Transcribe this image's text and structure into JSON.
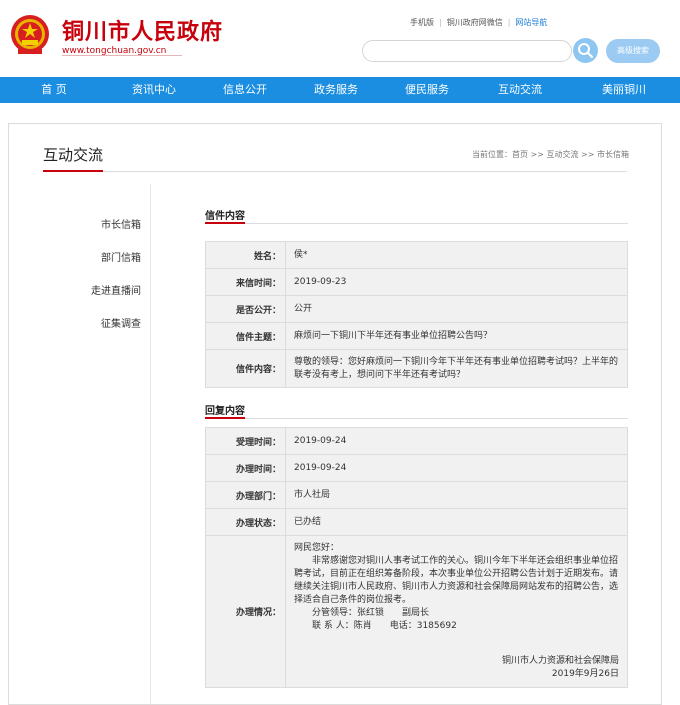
{
  "header": {
    "site_title": "铜川市人民政府",
    "site_url": "www.tongchuan.gov.cn",
    "links": [
      "手机版",
      "铜川政府网微信",
      "网站导航"
    ],
    "search_placeholder": "",
    "advanced_search": "高级搜索"
  },
  "nav": [
    "首 页",
    "资讯中心",
    "信息公开",
    "政务服务",
    "便民服务",
    "互动交流",
    "美丽铜川"
  ],
  "page": {
    "heading": "互动交流",
    "breadcrumb": "当前位置：首页 >> 互动交流 >> 市长信箱"
  },
  "sidebar": [
    "市长信箱",
    "部门信箱",
    "走进直播间",
    "征集调查"
  ],
  "letter": {
    "title": "信件内容",
    "rows": [
      {
        "label": "姓名：",
        "value": "侯*"
      },
      {
        "label": "来信时间：",
        "value": "2019-09-23"
      },
      {
        "label": "是否公开：",
        "value": "公开"
      },
      {
        "label": "信件主题：",
        "value": "麻烦问一下铜川下半年还有事业单位招聘公告吗？"
      },
      {
        "label": "信件内容：",
        "value": "尊敬的领导：您好麻烦问一下铜川今年下半年还有事业单位招聘考试吗？上半年的联考没有考上，想问问下半年还有考试吗？"
      }
    ]
  },
  "reply": {
    "title": "回复内容",
    "rows": [
      {
        "label": "受理时间：",
        "value": "2019-09-24"
      },
      {
        "label": "办理时间：",
        "value": "2019-09-24"
      },
      {
        "label": "办理部门：",
        "value": "市人社局"
      },
      {
        "label": "办理状态：",
        "value": "已办结"
      }
    ],
    "detail_label": "办理情况：",
    "detail": {
      "greeting": "网民您好：",
      "body": "非常感谢您对铜川人事考试工作的关心。铜川今年下半年还会组织事业单位招聘考试，目前正在组织筹备阶段，本次事业单位公开招聘公告计划于近期发布。请继续关注铜川市人民政府、铜川市人力资源和社会保障局网站发布的招聘公告，选择适合自己条件的岗位报考。",
      "leader": "分管领导：张红锁　　副局长",
      "contact": "联 系 人：陈肖　　电话：3185692",
      "signature": "铜川市人力资源和社会保障局",
      "date": "2019年9月26日"
    }
  }
}
